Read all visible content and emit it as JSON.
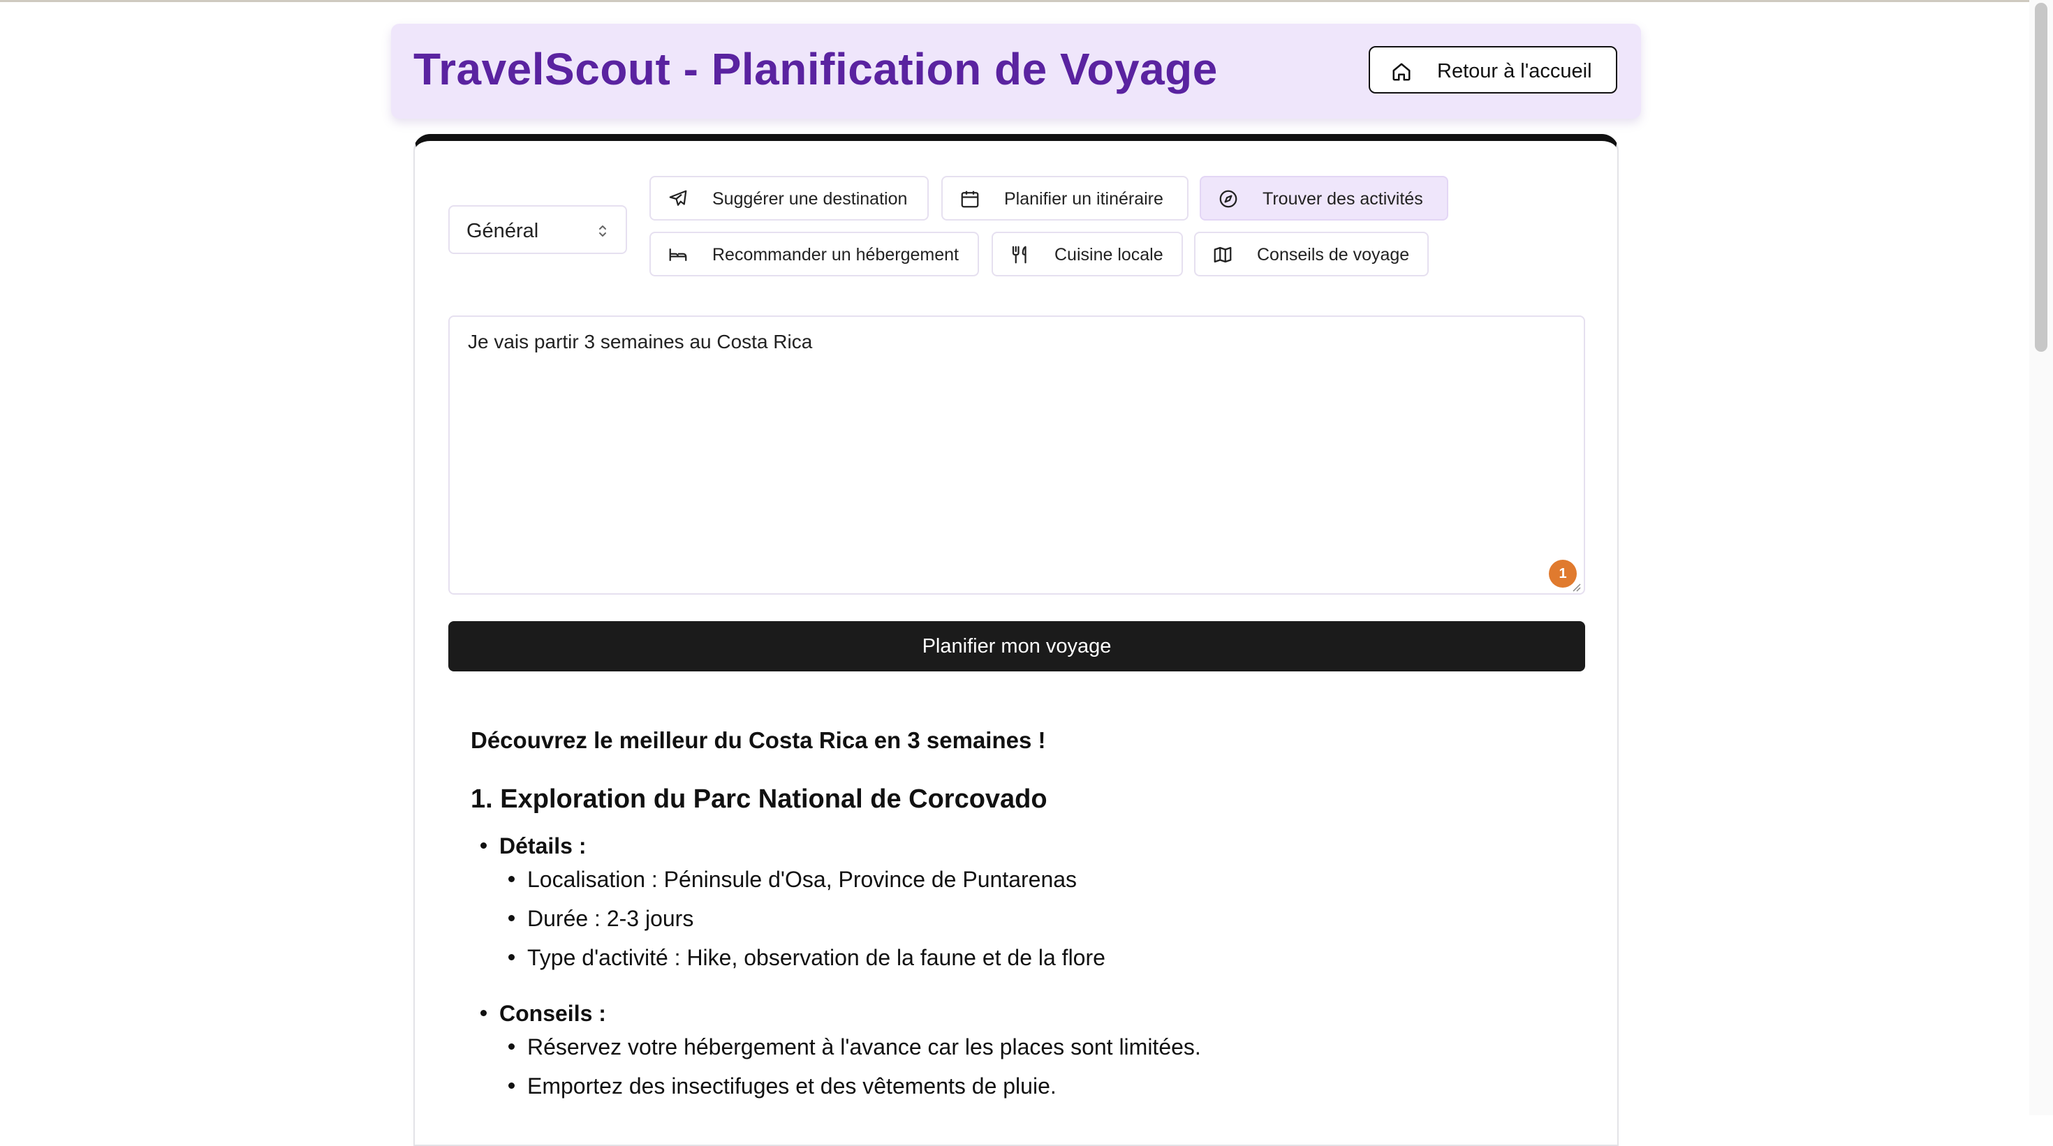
{
  "header": {
    "title": "TravelScout - Planification de Voyage",
    "home_button": "Retour à l'accueil"
  },
  "form": {
    "category_select": "Général",
    "quick_actions": [
      {
        "label": "Suggérer une destination",
        "icon": "plane-icon",
        "active": false
      },
      {
        "label": "Planifier un itinéraire",
        "icon": "calendar-icon",
        "active": false
      },
      {
        "label": "Trouver des activités",
        "icon": "compass-icon",
        "active": true
      },
      {
        "label": "Recommander un hébergement",
        "icon": "bed-icon",
        "active": false
      },
      {
        "label": "Cuisine locale",
        "icon": "utensils-icon",
        "active": false
      },
      {
        "label": "Conseils de voyage",
        "icon": "map-icon",
        "active": false
      }
    ],
    "prompt_value": "Je vais partir 3 semaines au Costa Rica",
    "badge_count": "1",
    "submit_label": "Planifier mon voyage"
  },
  "result": {
    "heading": "Découvrez le meilleur du Costa Rica en 3 semaines !",
    "section_title": "1. Exploration du Parc National de Corcovado",
    "details_label": "Détails :",
    "details": [
      "Localisation : Péninsule d'Osa, Province de Puntarenas",
      "Durée : 2-3 jours",
      "Type d'activité : Hike, observation de la faune et de la flore"
    ],
    "tips_label": "Conseils :",
    "tips": [
      "Réservez votre hébergement à l'avance car les places sont limitées.",
      "Emportez des insectifuges et des vêtements de pluie."
    ]
  },
  "colors": {
    "brand_purple": "#5a23a0",
    "header_bg": "#efe6fb",
    "active_chip_bg": "#efe6fb",
    "submit_bg": "#1b1b1b",
    "badge": "#e07a2e"
  }
}
